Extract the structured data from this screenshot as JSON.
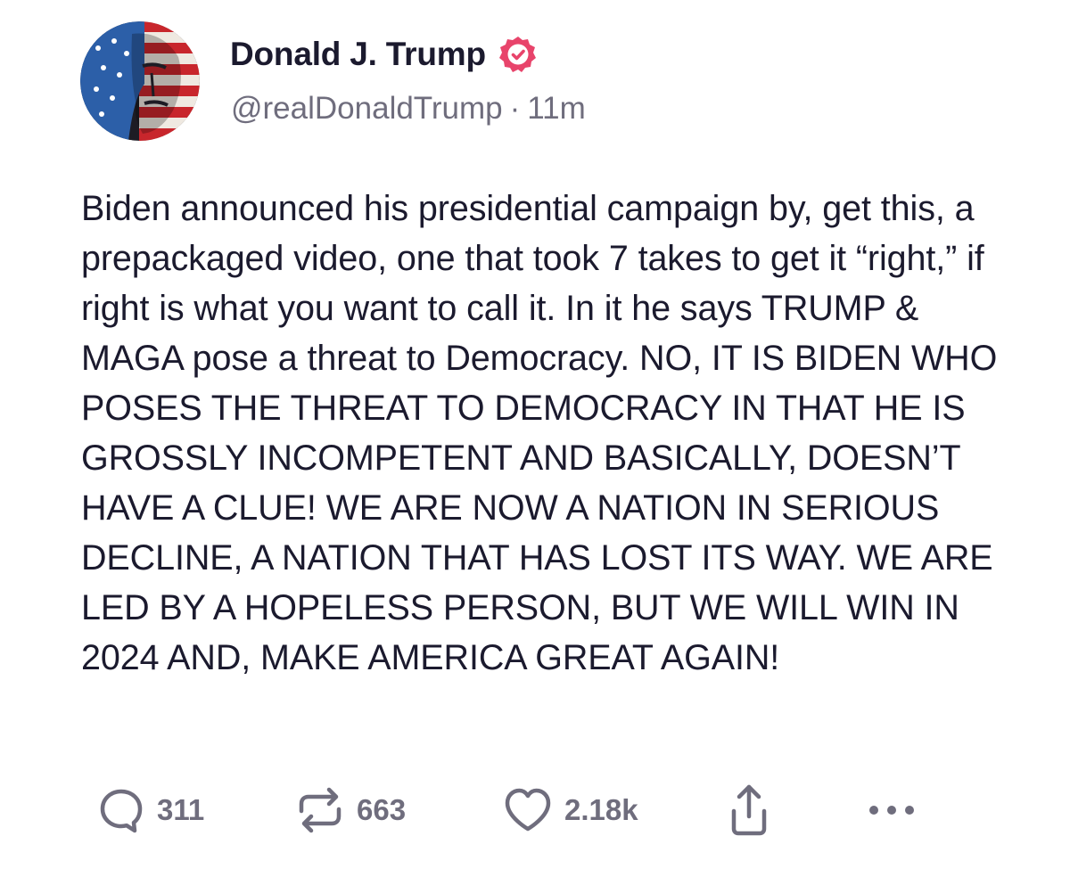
{
  "author": {
    "display_name": "Donald J. Trump",
    "handle": "@realDonaldTrump",
    "separator": "·",
    "timestamp": "11m",
    "avatar_icon": "flag-portrait-avatar",
    "verified_icon": "verified-badge-icon",
    "verified_color": "#e8446b"
  },
  "post": {
    "text": "Biden announced his presidential campaign by, get this, a prepackaged video, one that took 7 takes to get it “right,” if right is what you want to call it. In it he says TRUMP & MAGA pose a threat to Democracy. NO, IT IS BIDEN WHO POSES THE THREAT TO DEMOCRACY IN THAT HE IS GROSSLY INCOMPETENT AND BASICALLY, DOESN’T HAVE A CLUE! WE ARE NOW A NATION IN SERIOUS DECLINE, A NATION THAT HAS LOST ITS WAY. WE ARE LED BY A HOPELESS PERSON, BUT WE WILL WIN IN 2024 AND, MAKE AMERICA GREAT AGAIN!"
  },
  "actions": {
    "reply": {
      "icon": "reply-bubble-icon",
      "count": "311"
    },
    "repost": {
      "icon": "repost-arrows-icon",
      "count": "663"
    },
    "like": {
      "icon": "heart-icon",
      "count": "2.18k"
    },
    "share": {
      "icon": "share-icon"
    },
    "more": {
      "icon": "more-dots-icon"
    }
  },
  "colors": {
    "text": "#1b1a2e",
    "muted": "#6f6d7d",
    "accent": "#e8446b",
    "background": "#ffffff"
  }
}
